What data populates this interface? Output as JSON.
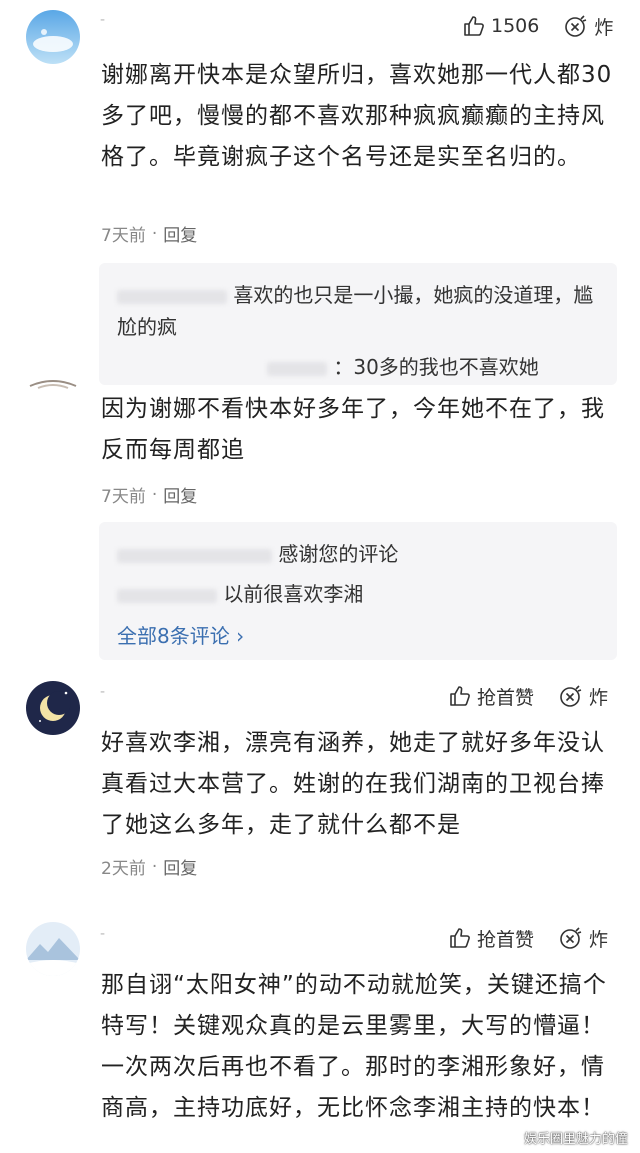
{
  "comments": [
    {
      "like": "1506",
      "boom": "炸",
      "text": "谢娜离开快本是众望所归，喜欢她那一代人都30多了吧，慢慢的都不喜欢那种疯疯癫癫的主持风格了。毕竟谢疯子这个名号还是实至名归的。",
      "time": "7天前",
      "reply": "回复",
      "replies": [
        "喜欢的也只是一小撮，她疯的没道理，尴尬的疯",
        "：30多的我也不喜欢她"
      ]
    },
    {
      "text": "因为谢娜不看快本好多年了，今年她不在了，我反而每周都追",
      "time": "7天前",
      "reply": "回复",
      "replies": [
        "感谢您的评论",
        "以前很喜欢李湘"
      ],
      "more": "全部8条评论"
    },
    {
      "like": "抢首赞",
      "boom": "炸",
      "text": "好喜欢李湘，漂亮有涵养，她走了就好多年没认真看过大本营了。姓谢的在我们湖南的卫视台捧了她这么多年，走了就什么都不是",
      "time": "2天前",
      "reply": "回复"
    },
    {
      "like": "抢首赞",
      "boom": "炸",
      "text": "那自诩“太阳女神”的动不动就尬笑，关键还搞个特写！关键观众真的是云里雾里，大写的懵逼！一次两次后再也不看了。那时的李湘形象好，情商高，主持功底好，无比怀念李湘主持的快本！"
    }
  ],
  "watermark": "娱乐圈里魅力的僮",
  "colors": {
    "link": "#3b6fb0",
    "meta": "#888888",
    "reply_bg": "#f5f5f7"
  }
}
